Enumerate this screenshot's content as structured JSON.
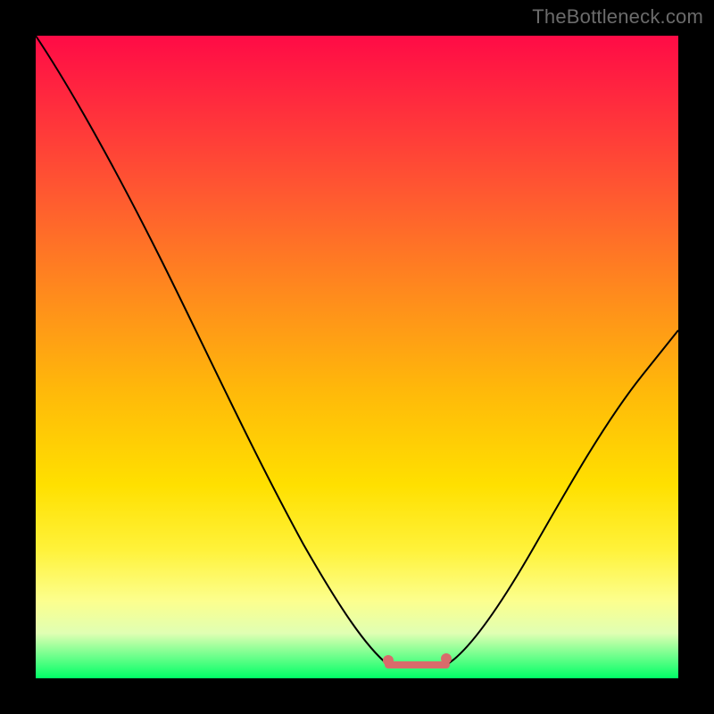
{
  "watermark": "TheBottleneck.com",
  "chart_data": {
    "type": "line",
    "title": "",
    "xlabel": "",
    "ylabel": "",
    "xlim": [
      0,
      1
    ],
    "ylim": [
      0,
      100
    ],
    "series": [
      {
        "name": "bottleneck-curve",
        "x": [
          0.0,
          0.05,
          0.1,
          0.15,
          0.2,
          0.25,
          0.3,
          0.35,
          0.4,
          0.45,
          0.5,
          0.53,
          0.55,
          0.58,
          0.6,
          0.63,
          0.66,
          0.7,
          0.75,
          0.8,
          0.85,
          0.9,
          0.95,
          1.0
        ],
        "values": [
          100,
          92,
          83,
          73,
          62,
          51,
          40,
          30,
          21,
          13,
          6,
          2,
          0,
          0,
          0,
          0,
          2,
          6,
          13,
          20,
          28,
          36,
          44,
          52
        ]
      }
    ],
    "highlight": {
      "name": "optimal-range",
      "x_start": 0.55,
      "x_end": 0.64,
      "value": 0
    },
    "background_gradient": {
      "stops": [
        {
          "pct": 0,
          "color": "#ff0b46"
        },
        {
          "pct": 25,
          "color": "#ff5a30"
        },
        {
          "pct": 55,
          "color": "#ffb80a"
        },
        {
          "pct": 80,
          "color": "#fff23a"
        },
        {
          "pct": 93,
          "color": "#e0ffb3"
        },
        {
          "pct": 100,
          "color": "#00ff66"
        }
      ]
    }
  }
}
